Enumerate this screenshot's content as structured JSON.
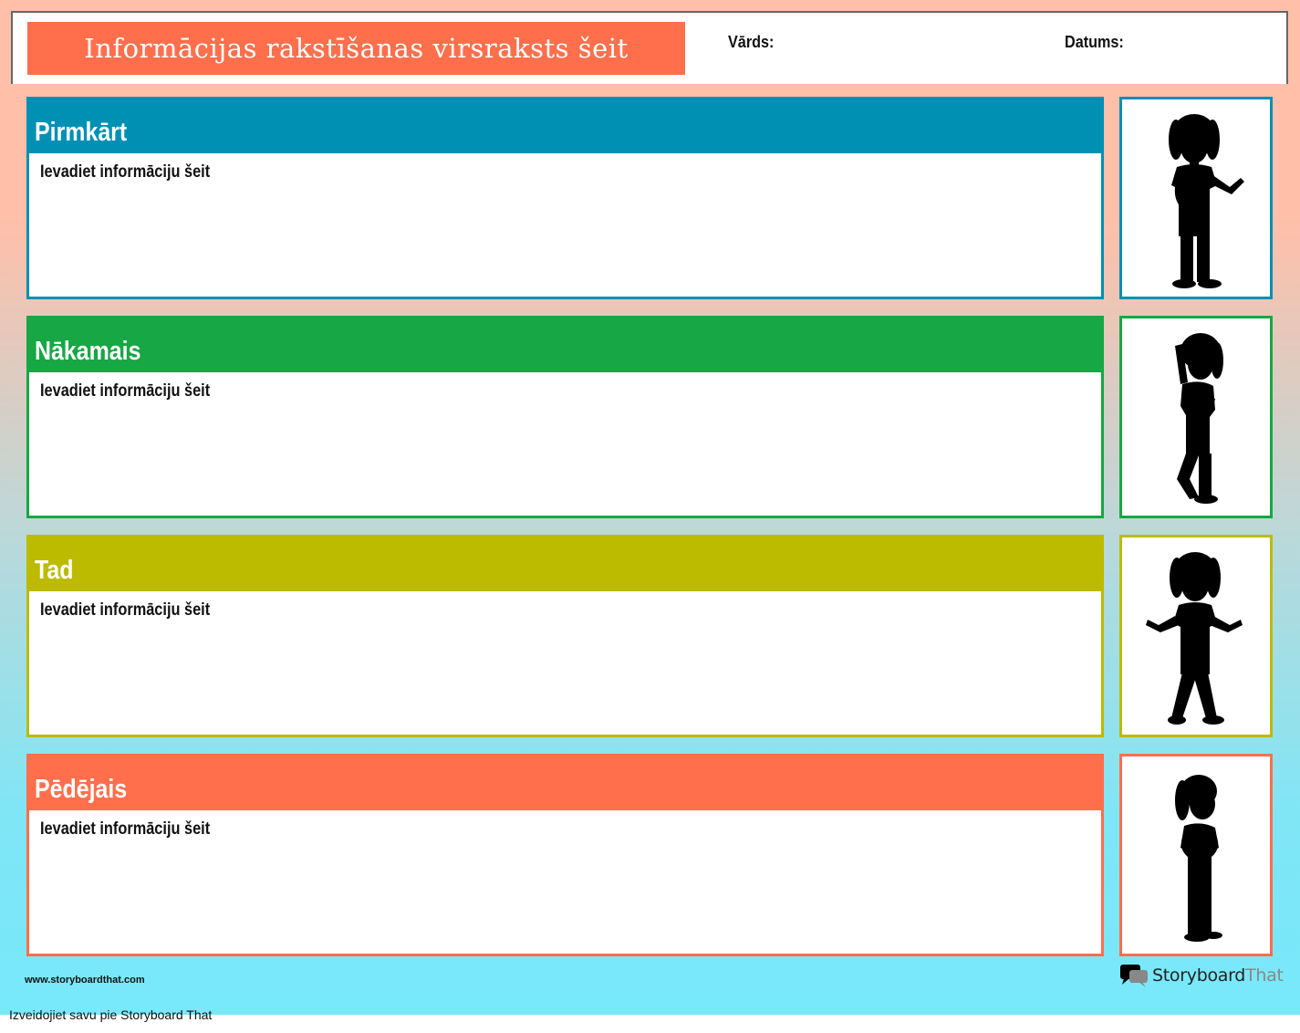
{
  "header": {
    "title": "Informācijas rakstīšanas virsraksts šeit",
    "name_label": "Vārds:",
    "date_label": "Datums:"
  },
  "sections": [
    {
      "heading": "Pirmkārt",
      "placeholder": "Ievadiet informāciju šeit",
      "color": "#0090b4"
    },
    {
      "heading": "Nākamais",
      "placeholder": "Ievadiet informāciju šeit",
      "color": "#17a744"
    },
    {
      "heading": "Tad",
      "placeholder": "Ievadiet informāciju šeit",
      "color": "#bcbb00"
    },
    {
      "heading": "Pēdējais",
      "placeholder": "Ievadiet informāciju šeit",
      "color": "#ff6f4c"
    }
  ],
  "footer": {
    "site": "www.storyboardthat.com",
    "brand_primary": "Storyboard",
    "brand_secondary": "That",
    "credit": "Izveidojiet savu pie Storyboard That"
  }
}
